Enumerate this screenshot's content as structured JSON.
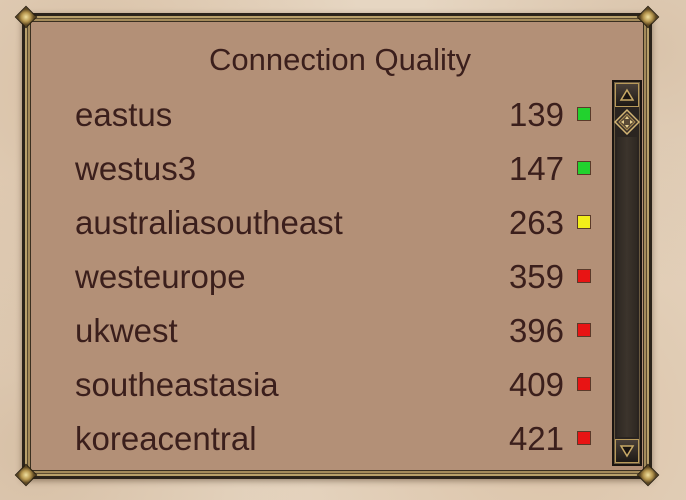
{
  "panel": {
    "title": "Connection Quality"
  },
  "regions": [
    {
      "name": "eastus",
      "ping": "139",
      "status_color": "#22d22e"
    },
    {
      "name": "westus3",
      "ping": "147",
      "status_color": "#22d22e"
    },
    {
      "name": "australiasoutheast",
      "ping": "263",
      "status_color": "#f2ee1a"
    },
    {
      "name": "westeurope",
      "ping": "359",
      "status_color": "#e81414"
    },
    {
      "name": "ukwest",
      "ping": "396",
      "status_color": "#e81414"
    },
    {
      "name": "southeastasia",
      "ping": "409",
      "status_color": "#e81414"
    },
    {
      "name": "koreacentral",
      "ping": "421",
      "status_color": "#e81414"
    }
  ],
  "scrollbar": {
    "up_icon": "triangle-up-icon",
    "thumb_icon": "move-diamond-icon",
    "down_icon": "triangle-down-icon"
  }
}
